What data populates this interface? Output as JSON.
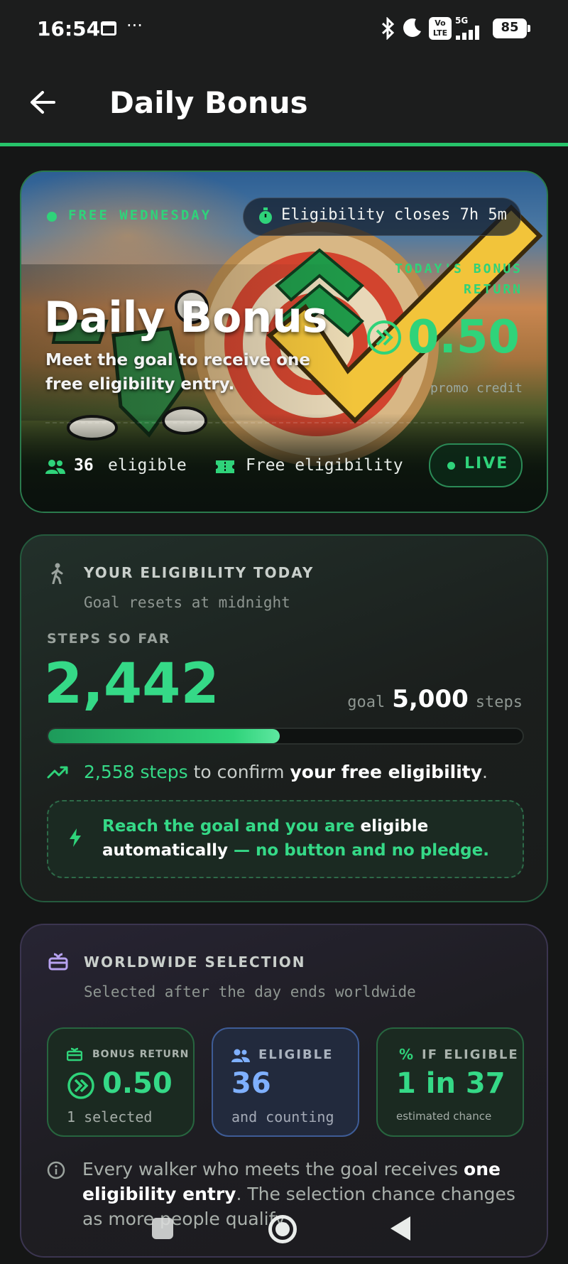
{
  "status_bar": {
    "time": "16:54",
    "more": "···",
    "volte": "Vo LTE",
    "network": "5G",
    "battery": "85"
  },
  "app_bar": {
    "title": "Daily Bonus"
  },
  "hero": {
    "day_badge": "FREE WEDNESDAY",
    "countdown": "Eligibility closes 7h 5m",
    "title": "Daily Bonus",
    "subtitle_line1": "Meet the goal to receive one",
    "subtitle_line2": "free eligibility entry.",
    "bonus_label_line1": "TODAY'S BONUS",
    "bonus_label_line2": "RETURN",
    "bonus_value": "0.50",
    "bonus_unit": "promo credit",
    "eligible_count": "36",
    "eligible_label": "eligible",
    "free_label": "Free eligibility",
    "live_label": "LIVE"
  },
  "eligibility": {
    "title": "YOUR ELIGIBILITY TODAY",
    "subtitle": "Goal resets at midnight",
    "steps_label": "STEPS SO FAR",
    "steps": "2,442",
    "goal_prefix": "goal",
    "goal": "5,000",
    "goal_suffix": "steps",
    "progress": 0.4884,
    "remaining_steps": "2,558 steps",
    "remaining_mid": "to confirm",
    "remaining_bold": "your free eligibility",
    "remaining_end": ".",
    "note_part1": "Reach the goal and you are",
    "note_bold1": "eligible",
    "note_bold2": "automatically",
    "note_part2": "— no button and no pledge."
  },
  "worldwide": {
    "title": "WORLDWIDE SELECTION",
    "subtitle": "Selected after the day ends worldwide",
    "stats": [
      {
        "label": "BONUS RETURN",
        "value": "0.50",
        "sub": "1 selected"
      },
      {
        "label": "ELIGIBLE",
        "value": "36",
        "sub": "and counting"
      },
      {
        "label": "IF ELIGIBLE",
        "value": "1 in 37",
        "sub": "estimated chance"
      }
    ],
    "info_part1": "Every walker who meets the goal receives",
    "info_bold": "one",
    "info_bold2": "eligibility entry",
    "info_part2": ". The selection chance changes as",
    "info_line3": "more people qualify."
  },
  "colors": {
    "accent": "#2fd37a",
    "blue": "#7fb0ff",
    "purple": "#b7a2f0",
    "bg": "#151616"
  }
}
